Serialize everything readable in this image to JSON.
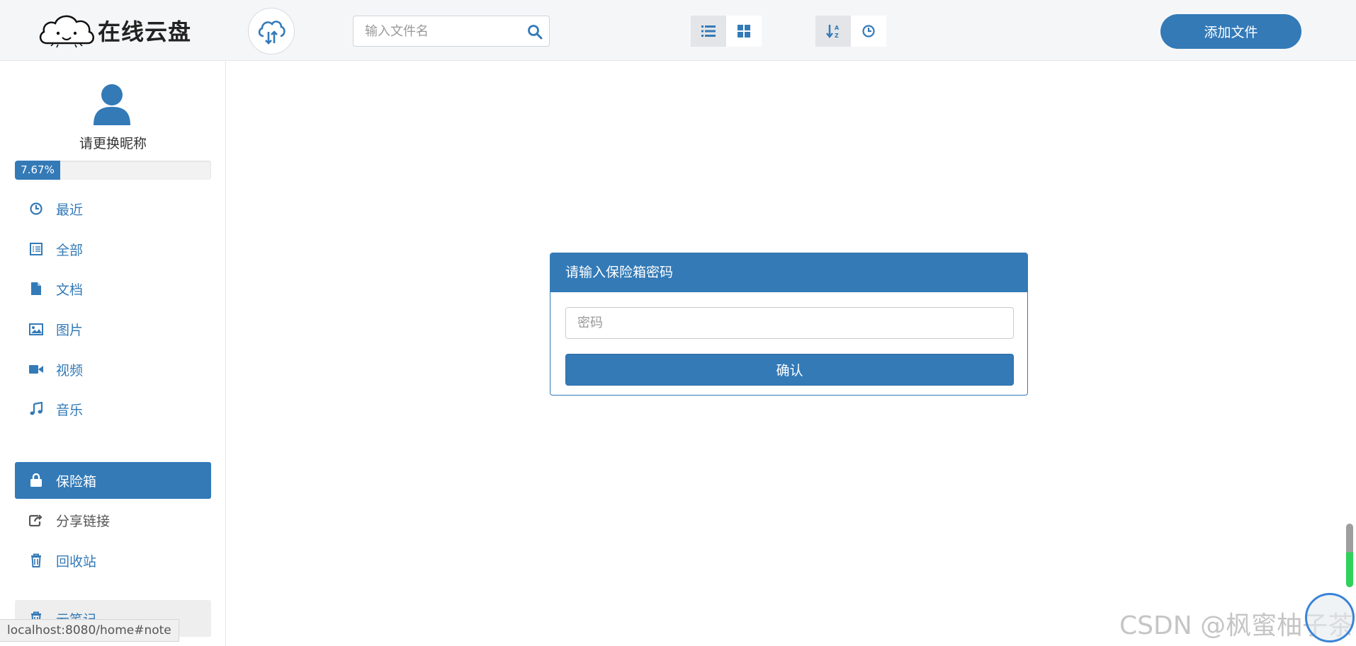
{
  "header": {
    "logo_text": "在线云盘",
    "search_placeholder": "输入文件名",
    "add_button": "添加文件"
  },
  "user": {
    "nickname": "请更换昵称",
    "usage_percent": 7.67,
    "usage_label": "7.67%"
  },
  "sidebar": {
    "items": [
      {
        "label": "最近",
        "icon": "clock-icon"
      },
      {
        "label": "全部",
        "icon": "list-icon"
      },
      {
        "label": "文档",
        "icon": "file-icon"
      },
      {
        "label": "图片",
        "icon": "image-icon"
      },
      {
        "label": "视频",
        "icon": "video-icon"
      },
      {
        "label": "音乐",
        "icon": "music-icon"
      },
      {
        "label": "保险箱",
        "icon": "lock-icon",
        "active": true
      },
      {
        "label": "分享链接",
        "icon": "share-icon"
      },
      {
        "label": "回收站",
        "icon": "trash-icon"
      },
      {
        "label": "云笔记",
        "icon": "trash-icon"
      }
    ]
  },
  "vault": {
    "title": "请输入保险箱密码",
    "password_placeholder": "密码",
    "confirm_label": "确认"
  },
  "status_bar": {
    "url": "localhost:8080/home#note"
  },
  "watermark": "CSDN @枫蜜柚子茶",
  "colors": {
    "primary": "#337ab7",
    "header_bg": "#f5f6f8"
  }
}
